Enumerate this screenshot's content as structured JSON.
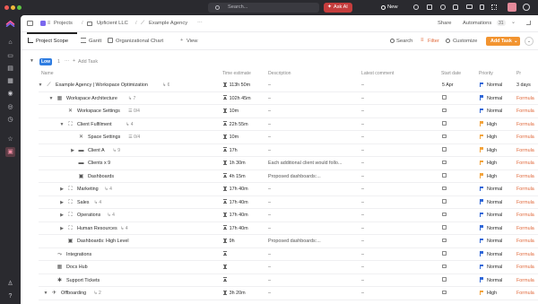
{
  "topbar": {
    "search_placeholder": "Search...",
    "ask_ai": "Ask AI",
    "new_label": "New"
  },
  "breadcrumb": {
    "space": "Projects",
    "folder": "Upficient LLC",
    "list": "Example Agency",
    "more": "···"
  },
  "header_actions": {
    "share": "Share",
    "automations": "Automations",
    "automations_count": "31"
  },
  "tabs": {
    "items": [
      {
        "label": "Project Scope",
        "icon": "list-icon",
        "active": true
      },
      {
        "label": "Gantt",
        "icon": "gantt-icon",
        "active": false
      },
      {
        "label": "Organizational Chart",
        "icon": "board-icon",
        "active": false
      }
    ],
    "add_view": "View",
    "search": "Search",
    "filter": "Filter",
    "customize": "Customize",
    "add_task": "Add Task"
  },
  "group": {
    "label": "Low",
    "count": "1",
    "more": "···",
    "add_task": "Add Task"
  },
  "columns": {
    "name": "Name",
    "time_estimate": "Time estimate",
    "description": "Description",
    "latest_comment": "Latest comment",
    "start_date": "Start date",
    "priority": "Priority",
    "formula": "Pr"
  },
  "colors": {
    "normal_flag": "#2f67d8",
    "high_flag": "#f2a33b",
    "formula_text": "#e0683a",
    "accent": "#f29430"
  },
  "rows": [
    {
      "name": "Example Agency | Workspace Optimization",
      "sub": "6",
      "est": "113h 50m",
      "desc": "–",
      "comment": "–",
      "start": "5 Apr",
      "priority": "Normal",
      "formula": "3 days"
    },
    {
      "name": "Workspace Architecture",
      "sub": "7",
      "est": "102h 45m",
      "desc": "–",
      "comment": "–",
      "start": "",
      "priority": "Normal",
      "formula": "Formula"
    },
    {
      "name": "Workspace Settings",
      "sub": "0/4",
      "est": "10m",
      "desc": "–",
      "comment": "–",
      "start": "",
      "priority": "Normal",
      "formula": "Formula"
    },
    {
      "name": "Client Fulfilment",
      "sub": "4",
      "est": "22h 55m",
      "desc": "–",
      "comment": "–",
      "start": "",
      "priority": "High",
      "formula": "Formula"
    },
    {
      "name": "Space Settings",
      "sub": "0/4",
      "est": "10m",
      "desc": "–",
      "comment": "–",
      "start": "",
      "priority": "High",
      "formula": "Formula"
    },
    {
      "name": "Client A",
      "sub": "9",
      "est": "17h",
      "desc": "–",
      "comment": "–",
      "start": "",
      "priority": "High",
      "formula": "Formula"
    },
    {
      "name": "Clients x 9",
      "sub": "",
      "est": "1h 30m",
      "desc": "Each additional client would follo...",
      "comment": "–",
      "start": "",
      "priority": "High",
      "formula": "Formula"
    },
    {
      "name": "Dashboards",
      "sub": "",
      "est": "4h 15m",
      "desc": "Proposed dashboards:...",
      "comment": "–",
      "start": "",
      "priority": "High",
      "formula": "Formula"
    },
    {
      "name": "Marketing",
      "sub": "4",
      "est": "17h 40m",
      "desc": "–",
      "comment": "–",
      "start": "",
      "priority": "Normal",
      "formula": "Formula"
    },
    {
      "name": "Sales",
      "sub": "4",
      "est": "17h 40m",
      "desc": "–",
      "comment": "–",
      "start": "",
      "priority": "Normal",
      "formula": "Formula"
    },
    {
      "name": "Operations",
      "sub": "4",
      "est": "17h 40m",
      "desc": "–",
      "comment": "–",
      "start": "",
      "priority": "Normal",
      "formula": "Formula"
    },
    {
      "name": "Human Resources",
      "sub": "4",
      "est": "17h 40m",
      "desc": "–",
      "comment": "–",
      "start": "",
      "priority": "Normal",
      "formula": "Formula"
    },
    {
      "name": "Dashboards: High Level",
      "sub": "",
      "est": "9h",
      "desc": "Proposed dashboards:...",
      "comment": "–",
      "start": "",
      "priority": "Normal",
      "formula": "Formula"
    },
    {
      "name": "Integrations",
      "sub": "",
      "est": "",
      "desc": "–",
      "comment": "–",
      "start": "",
      "priority": "Normal",
      "formula": "Formula"
    },
    {
      "name": "Docs Hub",
      "sub": "",
      "est": "",
      "desc": "–",
      "comment": "–",
      "start": "",
      "priority": "Normal",
      "formula": "Formula"
    },
    {
      "name": "Support Tickets",
      "sub": "",
      "est": "",
      "desc": "–",
      "comment": "–",
      "start": "",
      "priority": "Normal",
      "formula": "Formula"
    },
    {
      "name": "Offboarding",
      "sub": "2",
      "est": "3h 20m",
      "desc": "–",
      "comment": "–",
      "start": "",
      "priority": "High",
      "formula": "Formula"
    }
  ]
}
